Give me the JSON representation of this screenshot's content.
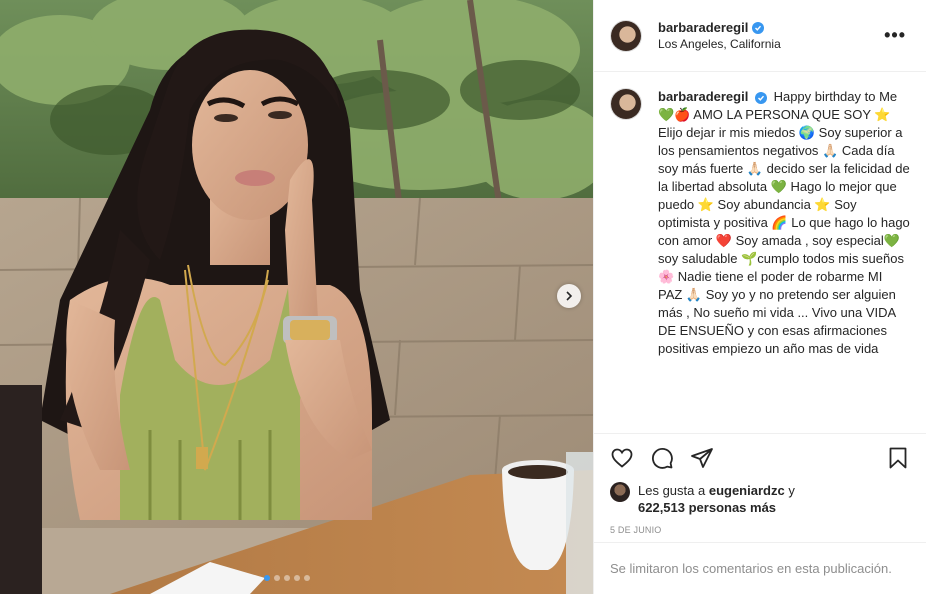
{
  "post": {
    "username": "barbaraderegil",
    "location": "Los Angeles, California",
    "more_label": "•••",
    "caption_username": "barbaraderegil",
    "caption_text": "Happy birthday to Me 💚🍎 AMO LA PERSONA QUE SOY ⭐ Elijo dejar ir mis miedos 🌍 Soy superior a los pensamientos negativos 🙏🏻 Cada día soy más fuerte 🙏🏻 decido ser la felicidad de la libertad absoluta 💚 Hago lo mejor que puedo ⭐ Soy abundancia ⭐ Soy optimista y positiva 🌈 Lo que hago lo hago con amor ❤️ Soy amada , soy especial💚 soy saludable 🌱cumplo todos mis sueños 🌸 Nadie tiene el poder de robarme MI PAZ 🙏🏻 Soy yo y no pretendo ser alguien más , No sueño mi vida ... Vivo una VIDA DE ENSUEÑO y con esas afirmaciones positivas empiezo un año mas de vida",
    "likes_prefix": "Les gusta a",
    "likes_user": "eugeniardzc",
    "likes_conjunction": "y",
    "likes_count": "622,513 personas más",
    "date": "5 DE JUNIO",
    "comments_disabled": "Se limitaron los comentarios en esta publicación."
  },
  "carousel": {
    "total_slides": 5,
    "active_slide": 1
  },
  "icons": {
    "verified": "verified-badge-icon",
    "like": "heart-icon",
    "comment": "comment-icon",
    "share": "paper-plane-icon",
    "save": "bookmark-icon",
    "next": "chevron-right-icon"
  },
  "colors": {
    "verified_blue": "#3897f0",
    "active_dot": "#3897f0",
    "muted_text": "#8e8e8e"
  }
}
